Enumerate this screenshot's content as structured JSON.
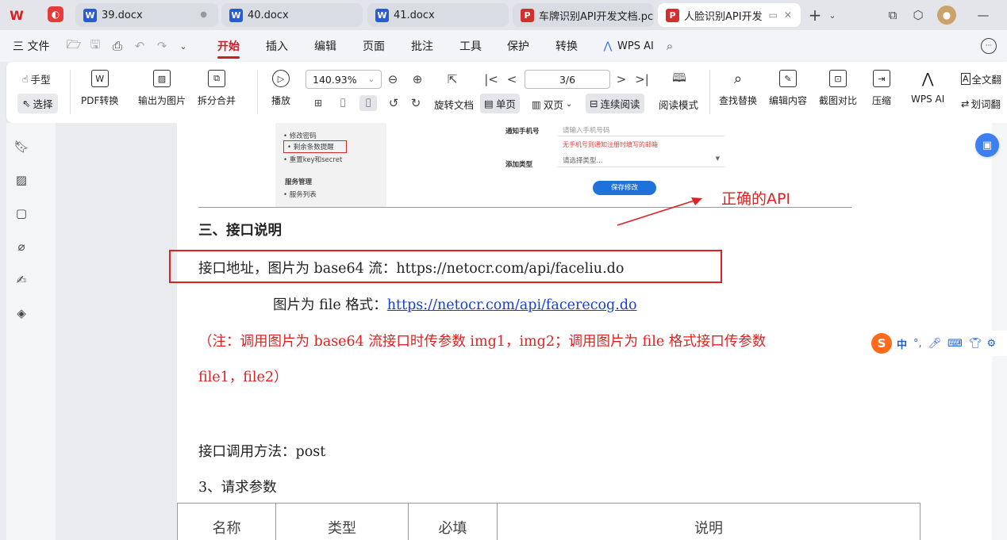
{
  "tabs": [
    {
      "label": "39.docx",
      "badge": "W"
    },
    {
      "label": "40.docx",
      "badge": "W"
    },
    {
      "label": "41.docx",
      "badge": "W"
    },
    {
      "label": "车牌识别API开发文档.pc",
      "badge": "P"
    },
    {
      "label": "人脸识别API开发",
      "badge": "P"
    }
  ],
  "menu": {
    "file": "三 文件",
    "items": [
      "开始",
      "插入",
      "编辑",
      "页面",
      "批注",
      "工具",
      "保护",
      "转换",
      "WPS AI"
    ]
  },
  "ribbon": {
    "hand": "手型",
    "select": "选择",
    "pdf_convert": "PDF转换",
    "export_image": "输出为图片",
    "split_merge": "拆分合并",
    "play": "播放",
    "zoom": "140.93%",
    "page_indicator": "3/6",
    "rotate": "旋转文档",
    "single": "单页",
    "double": "双页",
    "continuous": "连续阅读",
    "read_mode": "阅读模式",
    "find_replace": "查找替换",
    "edit_content": "编辑内容",
    "screenshot_compare": "截图对比",
    "compress": "压缩",
    "wps_ai": "WPS AI",
    "full_translate": "全文翻",
    "word_translate": "划词翻"
  },
  "embedded_shot": {
    "sidebar_items": [
      "修改密码",
      "剩余条数提醒",
      "重置key和secret"
    ],
    "section_title": "服务管理",
    "service_items": [
      "服务列表"
    ],
    "notify_label": "通知手机号",
    "notify_placeholder": "请输入手机号码",
    "notify_hint": "无手机号则通知注册时填写的邮箱",
    "type_label": "添加类型",
    "type_placeholder": "请选择类型...",
    "save_button": "保存修改"
  },
  "annotation_text": "正确的API",
  "doc": {
    "heading": "三、接口说明",
    "url_line_label": "接口地址，图片为 base64 流：",
    "url_base64": "https://netocr.com/api/faceliu.do",
    "url_file_label": "图片为 file 格式：",
    "url_file": "https://netocr.com/api/facerecog.do",
    "note_line1": "（注：调用图片为 base64 流接口时传参数 img1，img2；调用图片为 file 格式接口传参数",
    "note_line2": "file1，file2）",
    "method": "接口调用方法：post",
    "params_heading": "3、请求参数",
    "table_headers": [
      "名称",
      "类型",
      "必填",
      "说明"
    ]
  },
  "ime": {
    "lang": "中"
  }
}
